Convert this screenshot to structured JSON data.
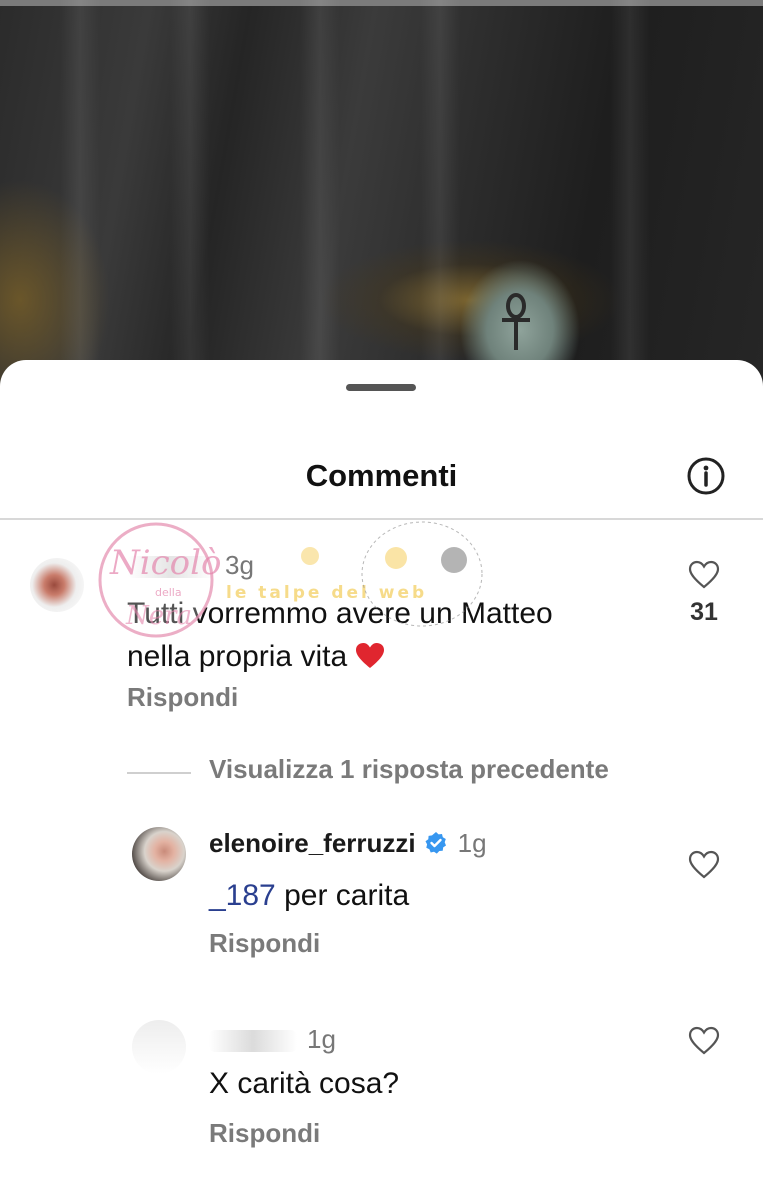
{
  "sheet": {
    "title": "Commenti",
    "info_icon": "info-icon"
  },
  "comments": [
    {
      "username": "",
      "time": "3g",
      "text_line1": "Tutti vorremmo avere un Matteo",
      "text_line2": "nella propria vita",
      "emoji": "❤️",
      "reply_label": "Rispondi",
      "likes": "31"
    }
  ],
  "view_replies": {
    "label": "Visualizza 1 risposta precedente"
  },
  "replies": [
    {
      "username": "elenoire_ferruzzi",
      "verified": true,
      "time": "1g",
      "mention": "_187",
      "text": " per carita",
      "reply_label": "Rispondi"
    },
    {
      "username": "",
      "time": "1g",
      "text": "X carità cosa?",
      "reply_label": "Rispondi"
    }
  ],
  "watermark": {
    "name": "Nicolò",
    "subtitle": "le talpe del web"
  },
  "colors": {
    "sheet_bg": "#ffffff",
    "secondary_text": "#7a7a7a",
    "verified_blue": "#3797f0",
    "heart_red": "#e0262f"
  }
}
